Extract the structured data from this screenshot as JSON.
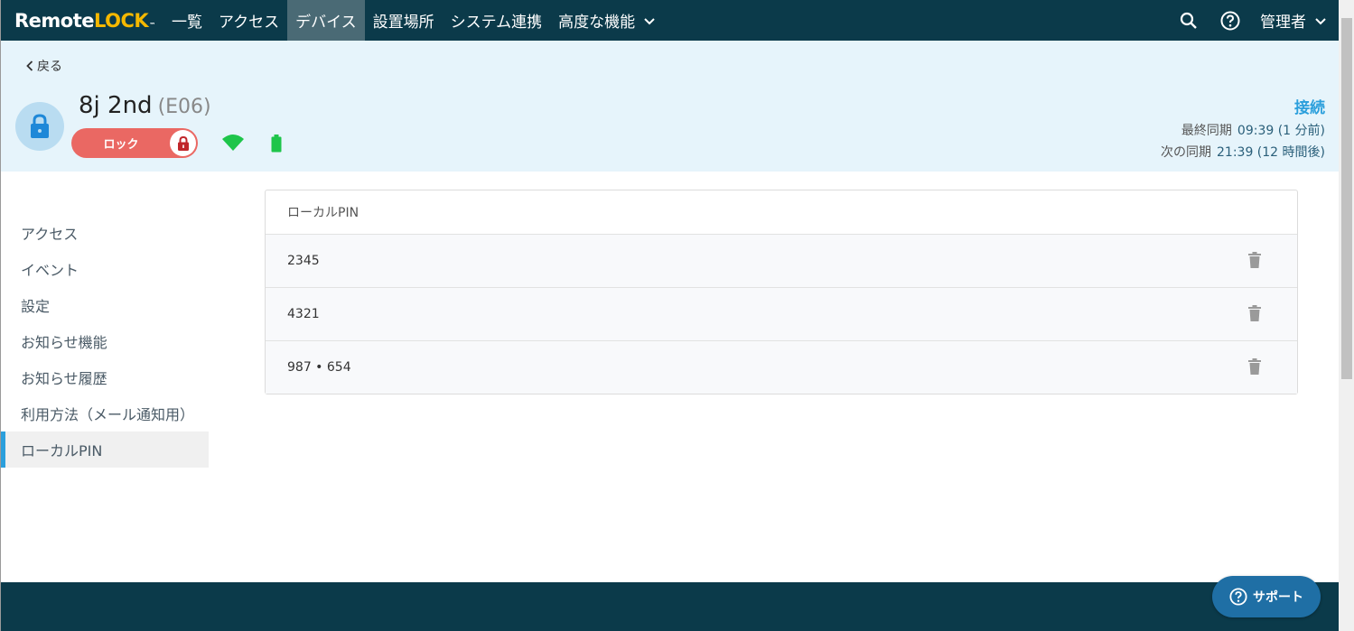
{
  "app": {
    "logo_pre": "Remote",
    "logo_post": "LOCK",
    "logo_tm": "™"
  },
  "nav": {
    "items": [
      {
        "label": "一覧"
      },
      {
        "label": "アクセス"
      },
      {
        "label": "デバイス",
        "active": true
      },
      {
        "label": "設置場所"
      },
      {
        "label": "システム連携"
      },
      {
        "label": "高度な機能"
      }
    ],
    "admin_label": "管理者"
  },
  "header": {
    "back_label": "戻る",
    "device_name": "8j 2nd",
    "device_code": "(E06)",
    "lock_label": "ロック",
    "connection": "接続",
    "last_sync_label": "最終同期",
    "last_sync_value": "09:39 (1 分前)",
    "next_sync_label": "次の同期",
    "next_sync_value": "21:39 (12 時間後)",
    "colors": {
      "accent": "#2b9fdc",
      "lock": "#ea6863",
      "wifi": "#1ec54a"
    }
  },
  "sidebar": {
    "items": [
      {
        "label": "アクセス"
      },
      {
        "label": "イベント"
      },
      {
        "label": "設定"
      },
      {
        "label": "お知らせ機能"
      },
      {
        "label": "お知らせ履歴"
      },
      {
        "label": "利用方法（メール通知用）"
      },
      {
        "label": "ローカルPIN",
        "active": true
      }
    ]
  },
  "table": {
    "header": "ローカルPIN",
    "rows": [
      {
        "pin": "2345"
      },
      {
        "pin": "4321"
      },
      {
        "pin": "987 • 654"
      }
    ]
  },
  "support": {
    "label": "サポート"
  }
}
